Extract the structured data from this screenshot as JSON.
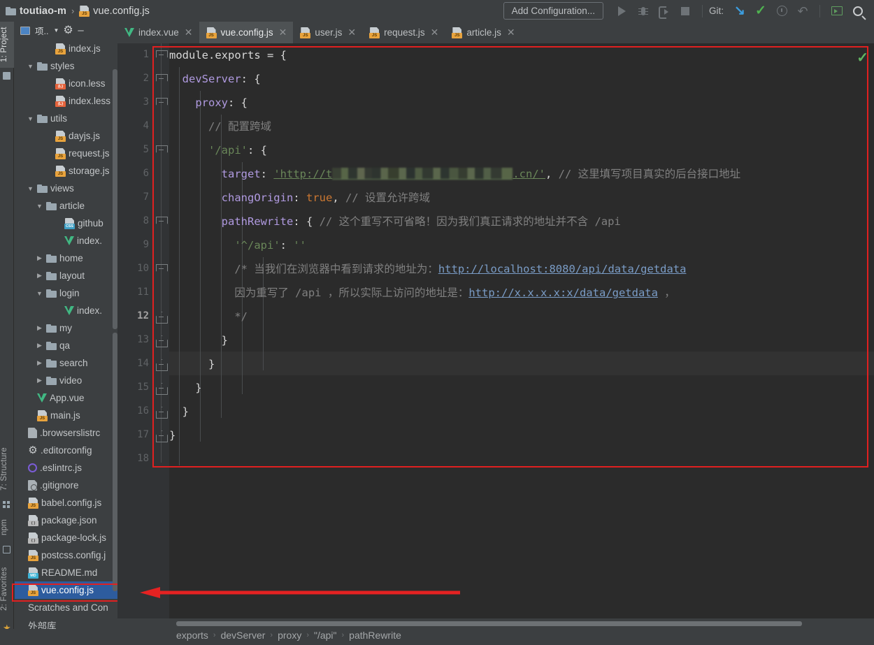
{
  "window": {
    "project_name": "toutiao-m",
    "current_file": "vue.config.js",
    "breadcrumb_separator": "›"
  },
  "toolbar": {
    "add_configuration": "Add Configuration...",
    "git_label": "Git:",
    "icons": [
      "run-icon",
      "debug-icon",
      "attach-debugger-icon",
      "stop-icon",
      "git-update-icon",
      "git-commit-icon",
      "history-icon",
      "rollback-icon",
      "terminal-icon",
      "search-everywhere-icon"
    ]
  },
  "left_strips": [
    {
      "label": "1: Project",
      "active": true
    },
    {
      "label": "7: Structure",
      "active": false
    },
    {
      "label": "npm",
      "active": false
    },
    {
      "label": "2: Favorites",
      "active": false
    }
  ],
  "project_panel": {
    "title": "项..",
    "gear_icon": "gear-icon",
    "minimize_icon": "minimize-icon",
    "tree": [
      {
        "indent": 3,
        "arrow": "",
        "icon": "js",
        "label": "index.js"
      },
      {
        "indent": 1,
        "arrow": "down",
        "icon": "folder",
        "label": "styles"
      },
      {
        "indent": 3,
        "arrow": "",
        "icon": "less",
        "label": "icon.less"
      },
      {
        "indent": 3,
        "arrow": "",
        "icon": "less",
        "label": "index.less"
      },
      {
        "indent": 1,
        "arrow": "down",
        "icon": "folder",
        "label": "utils"
      },
      {
        "indent": 3,
        "arrow": "",
        "icon": "js",
        "label": "dayjs.js"
      },
      {
        "indent": 3,
        "arrow": "",
        "icon": "js",
        "label": "request.js"
      },
      {
        "indent": 3,
        "arrow": "",
        "icon": "js",
        "label": "storage.js"
      },
      {
        "indent": 1,
        "arrow": "down",
        "icon": "folder",
        "label": "views"
      },
      {
        "indent": 2,
        "arrow": "down",
        "icon": "folder",
        "label": "article"
      },
      {
        "indent": 4,
        "arrow": "",
        "icon": "css",
        "label": "github"
      },
      {
        "indent": 4,
        "arrow": "",
        "icon": "vue",
        "label": "index."
      },
      {
        "indent": 2,
        "arrow": "right",
        "icon": "folder",
        "label": "home"
      },
      {
        "indent": 2,
        "arrow": "right",
        "icon": "folder",
        "label": "layout"
      },
      {
        "indent": 2,
        "arrow": "down",
        "icon": "folder",
        "label": "login"
      },
      {
        "indent": 4,
        "arrow": "",
        "icon": "vue",
        "label": "index."
      },
      {
        "indent": 2,
        "arrow": "right",
        "icon": "folder",
        "label": "my"
      },
      {
        "indent": 2,
        "arrow": "right",
        "icon": "folder",
        "label": "qa"
      },
      {
        "indent": 2,
        "arrow": "right",
        "icon": "folder",
        "label": "search"
      },
      {
        "indent": 2,
        "arrow": "right",
        "icon": "folder",
        "label": "video"
      },
      {
        "indent": 1,
        "arrow": "",
        "icon": "vue",
        "label": "App.vue"
      },
      {
        "indent": 1,
        "arrow": "",
        "icon": "js",
        "label": "main.js"
      },
      {
        "indent": 0,
        "arrow": "",
        "icon": "plain",
        "label": ".browserslistrc"
      },
      {
        "indent": 0,
        "arrow": "",
        "icon": "gearfile",
        "label": ".editorconfig"
      },
      {
        "indent": 0,
        "arrow": "",
        "icon": "circle",
        "label": ".eslintrc.js"
      },
      {
        "indent": 0,
        "arrow": "",
        "icon": "gitfile",
        "label": ".gitignore"
      },
      {
        "indent": 0,
        "arrow": "",
        "icon": "js",
        "label": "babel.config.js"
      },
      {
        "indent": 0,
        "arrow": "",
        "icon": "json",
        "label": "package.json"
      },
      {
        "indent": 0,
        "arrow": "",
        "icon": "json",
        "label": "package-lock.js"
      },
      {
        "indent": 0,
        "arrow": "",
        "icon": "js",
        "label": "postcss.config.j"
      },
      {
        "indent": 0,
        "arrow": "",
        "icon": "md",
        "label": "README.md"
      },
      {
        "indent": 0,
        "arrow": "",
        "icon": "js",
        "label": "vue.config.js",
        "selected": true
      },
      {
        "indent": 0,
        "arrow": "",
        "icon": "none",
        "label": "Scratches and Con"
      },
      {
        "indent": 0,
        "arrow": "",
        "icon": "none",
        "label": "外部库"
      }
    ]
  },
  "editor_tabs": [
    {
      "label": "index.vue",
      "icon": "vue",
      "active": false
    },
    {
      "label": "vue.config.js",
      "icon": "js",
      "active": true
    },
    {
      "label": "user.js",
      "icon": "js",
      "active": false
    },
    {
      "label": "request.js",
      "icon": "js",
      "active": false
    },
    {
      "label": "article.js",
      "icon": "js",
      "active": false
    }
  ],
  "editor": {
    "current_line": 12,
    "line_numbers": [
      1,
      2,
      3,
      4,
      5,
      6,
      7,
      8,
      9,
      10,
      11,
      12,
      13,
      14,
      15,
      16,
      17,
      18
    ],
    "lines": [
      {
        "n": 1,
        "segments": [
          {
            "t": "module",
            "c": "plain"
          },
          {
            "t": ".",
            "c": "plain"
          },
          {
            "t": "exports",
            "c": "plain"
          },
          {
            "t": " = {",
            "c": "plain"
          }
        ]
      },
      {
        "n": 2,
        "segments": [
          {
            "t": "  ",
            "c": "plain"
          },
          {
            "t": "devServer",
            "c": "prop"
          },
          {
            "t": ": {",
            "c": "plain"
          }
        ]
      },
      {
        "n": 3,
        "segments": [
          {
            "t": "    ",
            "c": "plain"
          },
          {
            "t": "proxy",
            "c": "prop"
          },
          {
            "t": ": {",
            "c": "plain"
          }
        ]
      },
      {
        "n": 4,
        "segments": [
          {
            "t": "      ",
            "c": "plain"
          },
          {
            "t": "// 配置跨域",
            "c": "cmt"
          }
        ]
      },
      {
        "n": 5,
        "segments": [
          {
            "t": "      ",
            "c": "plain"
          },
          {
            "t": "'/api'",
            "c": "str"
          },
          {
            "t": ": {",
            "c": "plain"
          }
        ]
      },
      {
        "n": 6,
        "segments": [
          {
            "t": "        ",
            "c": "plain"
          },
          {
            "t": "target",
            "c": "prop"
          },
          {
            "t": ": ",
            "c": "plain"
          },
          {
            "t": "'http://t",
            "c": "link"
          },
          {
            "t": "BLUR",
            "c": "blur"
          },
          {
            "t": ".cn/'",
            "c": "link"
          },
          {
            "t": ", ",
            "c": "plain"
          },
          {
            "t": "// 这里填写项目真实的后台接口地址",
            "c": "cmt"
          }
        ]
      },
      {
        "n": 7,
        "segments": [
          {
            "t": "        ",
            "c": "plain"
          },
          {
            "t": "changOrigin",
            "c": "prop"
          },
          {
            "t": ": ",
            "c": "plain"
          },
          {
            "t": "true",
            "c": "kw"
          },
          {
            "t": ", ",
            "c": "plain"
          },
          {
            "t": "// 设置允许跨域",
            "c": "cmt"
          }
        ]
      },
      {
        "n": 8,
        "segments": [
          {
            "t": "        ",
            "c": "plain"
          },
          {
            "t": "pathRewrite",
            "c": "prop"
          },
          {
            "t": ": { ",
            "c": "plain"
          },
          {
            "t": "// 这个重写不可省略！因为我们真正请求的地址并不含 /api",
            "c": "cmt"
          }
        ]
      },
      {
        "n": 9,
        "segments": [
          {
            "t": "          ",
            "c": "plain"
          },
          {
            "t": "'^/api'",
            "c": "str"
          },
          {
            "t": ": ",
            "c": "plain"
          },
          {
            "t": "''",
            "c": "str"
          }
        ]
      },
      {
        "n": 10,
        "segments": [
          {
            "t": "          ",
            "c": "plain"
          },
          {
            "t": "/* 当我们在浏览器中看到请求的地址为：",
            "c": "cmt"
          },
          {
            "t": "http://localhost:8080/api/data/getdata",
            "c": "cmtlink"
          }
        ]
      },
      {
        "n": 11,
        "segments": [
          {
            "t": "          ",
            "c": "plain"
          },
          {
            "t": "因为重写了 /api ，所以实际上访问的地址是：",
            "c": "cmt"
          },
          {
            "t": "http://x.x.x.x:x/data/getdata",
            "c": "cmtlink"
          },
          {
            "t": " ，",
            "c": "cmt"
          }
        ]
      },
      {
        "n": 12,
        "segments": [
          {
            "t": "          ",
            "c": "plain"
          },
          {
            "t": "*/",
            "c": "cmt"
          }
        ]
      },
      {
        "n": 13,
        "segments": [
          {
            "t": "        }",
            "c": "plain"
          }
        ]
      },
      {
        "n": 14,
        "segments": [
          {
            "t": "      }",
            "c": "plain"
          }
        ]
      },
      {
        "n": 15,
        "segments": [
          {
            "t": "    }",
            "c": "plain"
          }
        ]
      },
      {
        "n": 16,
        "segments": [
          {
            "t": "  }",
            "c": "plain"
          }
        ]
      },
      {
        "n": 17,
        "segments": [
          {
            "t": "}",
            "c": "plain"
          }
        ]
      },
      {
        "n": 18,
        "segments": []
      }
    ],
    "folds": [
      {
        "line": 1,
        "state": "open"
      },
      {
        "line": 2,
        "state": "open"
      },
      {
        "line": 3,
        "state": "open"
      },
      {
        "line": 5,
        "state": "open"
      },
      {
        "line": 8,
        "state": "open"
      },
      {
        "line": 10,
        "state": "open"
      },
      {
        "line": 12,
        "state": "close"
      },
      {
        "line": 13,
        "state": "close"
      },
      {
        "line": 14,
        "state": "close"
      },
      {
        "line": 15,
        "state": "close"
      },
      {
        "line": 16,
        "state": "close"
      },
      {
        "line": 17,
        "state": "close"
      }
    ],
    "inspection_status": "inspection-ok-check"
  },
  "bottom_breadcrumb": [
    "exports",
    "devServer",
    "proxy",
    "\"/api\"",
    "pathRewrite"
  ],
  "annotations": {
    "color": "#e02020",
    "editor_box": "red-rectangle-around-code",
    "sidebar_box": "red-rectangle-around-vue-config-js",
    "arrow": "red-left-arrow"
  },
  "colors": {
    "accent_red": "#e02020",
    "editor_bg": "#2b2b2b",
    "chrome_bg": "#3c3f41",
    "selection_blue": "#2d5c9e",
    "vue_green": "#41b883",
    "string_green": "#6a8759",
    "property_purple": "#b09ae0",
    "keyword_orange": "#cc7832",
    "comment_gray": "#808080"
  }
}
